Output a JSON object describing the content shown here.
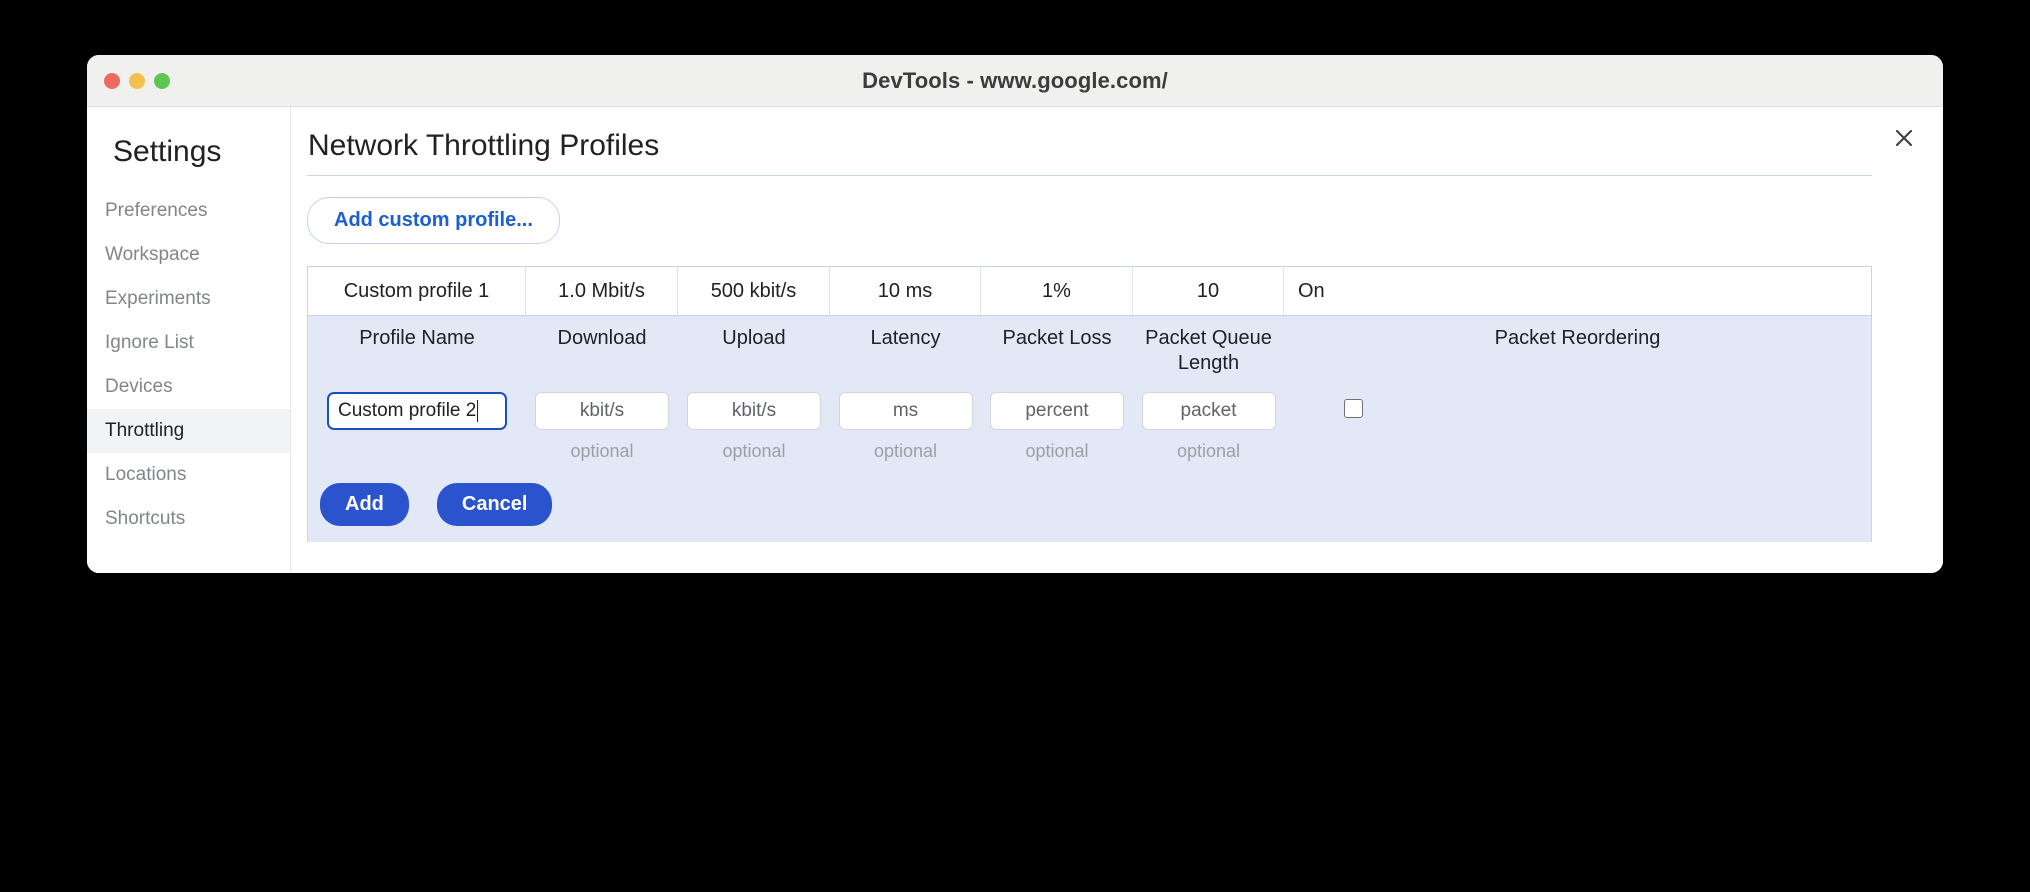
{
  "window": {
    "title": "DevTools - www.google.com/",
    "traffic_lights": [
      {
        "name": "close",
        "color": "#ed6a5e"
      },
      {
        "name": "minimize",
        "color": "#f5bf4f"
      },
      {
        "name": "maximize",
        "color": "#61c554"
      }
    ]
  },
  "sidebar": {
    "title": "Settings",
    "items": [
      {
        "label": "Preferences",
        "active": false
      },
      {
        "label": "Workspace",
        "active": false
      },
      {
        "label": "Experiments",
        "active": false
      },
      {
        "label": "Ignore List",
        "active": false
      },
      {
        "label": "Devices",
        "active": false
      },
      {
        "label": "Throttling",
        "active": true
      },
      {
        "label": "Locations",
        "active": false
      },
      {
        "label": "Shortcuts",
        "active": false
      }
    ]
  },
  "main": {
    "panel_title": "Network Throttling Profiles",
    "close_icon": "close-icon",
    "add_profile_label": "Add custom profile...",
    "table": {
      "existing_rows": [
        {
          "profile_name": "Custom profile 1",
          "download": "1.0 Mbit/s",
          "upload": "500 kbit/s",
          "latency": "10 ms",
          "packet_loss": "1%",
          "packet_queue_length": "10",
          "packet_reordering": "On"
        }
      ],
      "headers": [
        "Profile Name",
        "Download",
        "Upload",
        "Latency",
        "Packet Loss",
        "Packet Queue Length",
        "Packet Reordering"
      ],
      "editor": {
        "profile_name_value": "Custom profile 2",
        "profile_name_placeholder": "",
        "download_placeholder": "kbit/s",
        "upload_placeholder": "kbit/s",
        "latency_placeholder": "ms",
        "packet_loss_placeholder": "percent",
        "packet_queue_placeholder": "packet",
        "optional_labels": [
          "optional",
          "optional",
          "optional",
          "optional",
          "optional"
        ],
        "packet_reordering_checked": false,
        "add_label": "Add",
        "cancel_label": "Cancel"
      }
    }
  },
  "colors": {
    "accent_blue": "#2a53cd",
    "link_blue": "#1a5fd4",
    "editor_bg": "#e3e8f7",
    "table_border": "#c6d4f0",
    "titlebar_bg": "#f0f0ef"
  }
}
